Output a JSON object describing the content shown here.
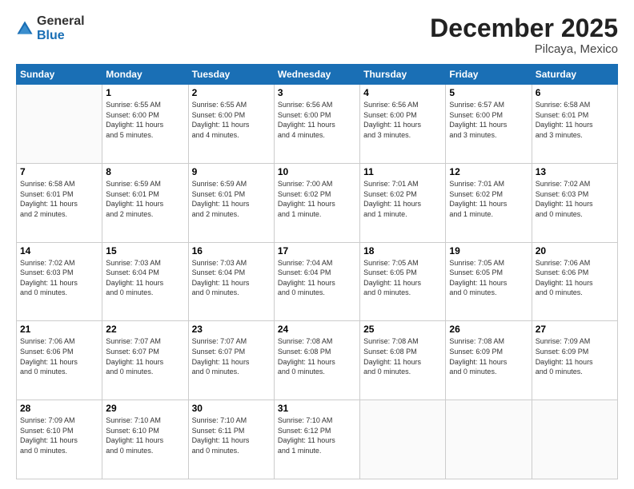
{
  "header": {
    "logo": {
      "general": "General",
      "blue": "Blue"
    },
    "title": "December 2025",
    "location": "Pilcaya, Mexico"
  },
  "weekdays": [
    "Sunday",
    "Monday",
    "Tuesday",
    "Wednesday",
    "Thursday",
    "Friday",
    "Saturday"
  ],
  "weeks": [
    [
      {
        "day": "",
        "info": ""
      },
      {
        "day": "1",
        "info": "Sunrise: 6:55 AM\nSunset: 6:00 PM\nDaylight: 11 hours\nand 5 minutes."
      },
      {
        "day": "2",
        "info": "Sunrise: 6:55 AM\nSunset: 6:00 PM\nDaylight: 11 hours\nand 4 minutes."
      },
      {
        "day": "3",
        "info": "Sunrise: 6:56 AM\nSunset: 6:00 PM\nDaylight: 11 hours\nand 4 minutes."
      },
      {
        "day": "4",
        "info": "Sunrise: 6:56 AM\nSunset: 6:00 PM\nDaylight: 11 hours\nand 3 minutes."
      },
      {
        "day": "5",
        "info": "Sunrise: 6:57 AM\nSunset: 6:00 PM\nDaylight: 11 hours\nand 3 minutes."
      },
      {
        "day": "6",
        "info": "Sunrise: 6:58 AM\nSunset: 6:01 PM\nDaylight: 11 hours\nand 3 minutes."
      }
    ],
    [
      {
        "day": "7",
        "info": "Sunrise: 6:58 AM\nSunset: 6:01 PM\nDaylight: 11 hours\nand 2 minutes."
      },
      {
        "day": "8",
        "info": "Sunrise: 6:59 AM\nSunset: 6:01 PM\nDaylight: 11 hours\nand 2 minutes."
      },
      {
        "day": "9",
        "info": "Sunrise: 6:59 AM\nSunset: 6:01 PM\nDaylight: 11 hours\nand 2 minutes."
      },
      {
        "day": "10",
        "info": "Sunrise: 7:00 AM\nSunset: 6:02 PM\nDaylight: 11 hours\nand 1 minute."
      },
      {
        "day": "11",
        "info": "Sunrise: 7:01 AM\nSunset: 6:02 PM\nDaylight: 11 hours\nand 1 minute."
      },
      {
        "day": "12",
        "info": "Sunrise: 7:01 AM\nSunset: 6:02 PM\nDaylight: 11 hours\nand 1 minute."
      },
      {
        "day": "13",
        "info": "Sunrise: 7:02 AM\nSunset: 6:03 PM\nDaylight: 11 hours\nand 0 minutes."
      }
    ],
    [
      {
        "day": "14",
        "info": "Sunrise: 7:02 AM\nSunset: 6:03 PM\nDaylight: 11 hours\nand 0 minutes."
      },
      {
        "day": "15",
        "info": "Sunrise: 7:03 AM\nSunset: 6:04 PM\nDaylight: 11 hours\nand 0 minutes."
      },
      {
        "day": "16",
        "info": "Sunrise: 7:03 AM\nSunset: 6:04 PM\nDaylight: 11 hours\nand 0 minutes."
      },
      {
        "day": "17",
        "info": "Sunrise: 7:04 AM\nSunset: 6:04 PM\nDaylight: 11 hours\nand 0 minutes."
      },
      {
        "day": "18",
        "info": "Sunrise: 7:05 AM\nSunset: 6:05 PM\nDaylight: 11 hours\nand 0 minutes."
      },
      {
        "day": "19",
        "info": "Sunrise: 7:05 AM\nSunset: 6:05 PM\nDaylight: 11 hours\nand 0 minutes."
      },
      {
        "day": "20",
        "info": "Sunrise: 7:06 AM\nSunset: 6:06 PM\nDaylight: 11 hours\nand 0 minutes."
      }
    ],
    [
      {
        "day": "21",
        "info": "Sunrise: 7:06 AM\nSunset: 6:06 PM\nDaylight: 11 hours\nand 0 minutes."
      },
      {
        "day": "22",
        "info": "Sunrise: 7:07 AM\nSunset: 6:07 PM\nDaylight: 11 hours\nand 0 minutes."
      },
      {
        "day": "23",
        "info": "Sunrise: 7:07 AM\nSunset: 6:07 PM\nDaylight: 11 hours\nand 0 minutes."
      },
      {
        "day": "24",
        "info": "Sunrise: 7:08 AM\nSunset: 6:08 PM\nDaylight: 11 hours\nand 0 minutes."
      },
      {
        "day": "25",
        "info": "Sunrise: 7:08 AM\nSunset: 6:08 PM\nDaylight: 11 hours\nand 0 minutes."
      },
      {
        "day": "26",
        "info": "Sunrise: 7:08 AM\nSunset: 6:09 PM\nDaylight: 11 hours\nand 0 minutes."
      },
      {
        "day": "27",
        "info": "Sunrise: 7:09 AM\nSunset: 6:09 PM\nDaylight: 11 hours\nand 0 minutes."
      }
    ],
    [
      {
        "day": "28",
        "info": "Sunrise: 7:09 AM\nSunset: 6:10 PM\nDaylight: 11 hours\nand 0 minutes."
      },
      {
        "day": "29",
        "info": "Sunrise: 7:10 AM\nSunset: 6:10 PM\nDaylight: 11 hours\nand 0 minutes."
      },
      {
        "day": "30",
        "info": "Sunrise: 7:10 AM\nSunset: 6:11 PM\nDaylight: 11 hours\nand 0 minutes."
      },
      {
        "day": "31",
        "info": "Sunrise: 7:10 AM\nSunset: 6:12 PM\nDaylight: 11 hours\nand 1 minute."
      },
      {
        "day": "",
        "info": ""
      },
      {
        "day": "",
        "info": ""
      },
      {
        "day": "",
        "info": ""
      }
    ]
  ]
}
